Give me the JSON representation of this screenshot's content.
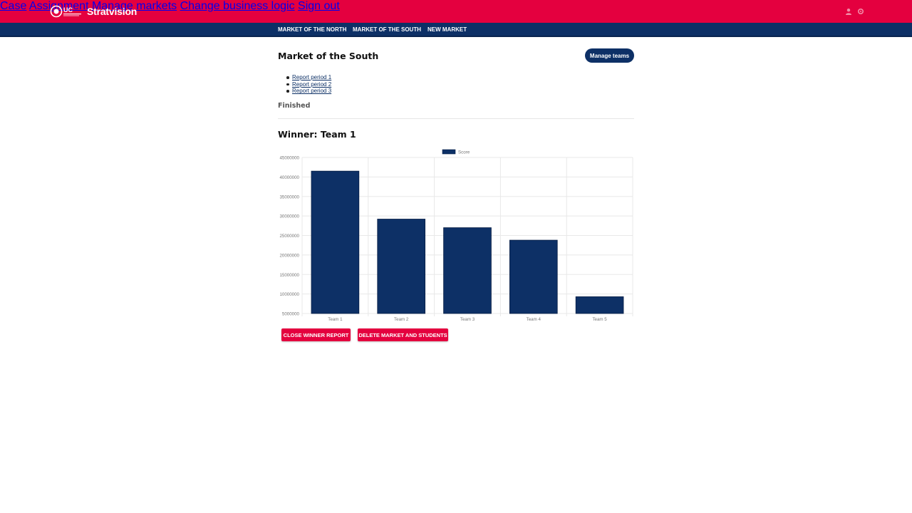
{
  "app": {
    "brand": "Stratvision",
    "colors": {
      "primary_red": "#e4003f",
      "navy": "#0d3066"
    }
  },
  "header": {
    "nav": [
      "Case",
      "Assignment",
      "Manage markets",
      "Change business logic",
      "Sign out"
    ],
    "icons": [
      "user-icon",
      "settings-icon"
    ]
  },
  "markets_nav": [
    "MARKET OF THE NORTH",
    "MARKET OF THE SOUTH",
    "NEW MARKET"
  ],
  "market": {
    "title": "Market of the South",
    "manage_teams_label": "Manage teams",
    "reports": [
      "Report period 1",
      "Report period 2",
      "Report period 3"
    ],
    "status": "Finished",
    "winner": "Winner: Team 1"
  },
  "actions": {
    "close_report": "CLOSE WINNER REPORT",
    "delete_market": "DELETE MARKET AND STUDENTS"
  },
  "chart_data": {
    "type": "bar",
    "categories": [
      "Team 1",
      "Team 2",
      "Team 3",
      "Team 4",
      "Team 5"
    ],
    "series": [
      {
        "name": "Score",
        "values": [
          41500000,
          29200000,
          27000000,
          23800000,
          9300000
        ],
        "color": "#0d3066"
      }
    ],
    "ylim": [
      5000000,
      45000000
    ],
    "yticks": [
      5000000,
      10000000,
      15000000,
      20000000,
      25000000,
      30000000,
      35000000,
      40000000,
      45000000
    ],
    "grid": true,
    "legend": "top"
  }
}
